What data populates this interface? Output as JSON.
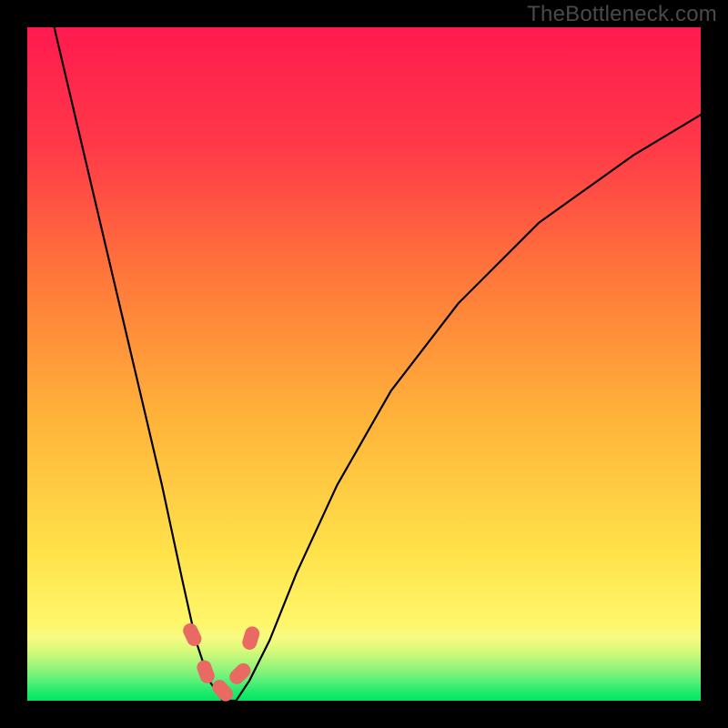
{
  "watermark": "TheBottleneck.com",
  "colors": {
    "frame": "#000000",
    "curve": "#000000",
    "band_green": "#00e661",
    "band_green_mid": "#6cf27a",
    "band_yellowgreen": "#d9f97a",
    "band_yellow": "#fff66a",
    "grad_top": "#ff1a4f",
    "grad_mid1": "#ff6a3a",
    "grad_mid2": "#ffb33a",
    "grad_mid3": "#ffe24a",
    "marker": "#e96a62"
  },
  "chart_data": {
    "type": "line",
    "title": "",
    "xlabel": "",
    "ylabel": "",
    "xlim": [
      0,
      100
    ],
    "ylim": [
      0,
      100
    ],
    "annotations": [
      "TheBottleneck.com"
    ],
    "series": [
      {
        "name": "bottleneck-curve",
        "x": [
          4,
          8,
          12,
          16,
          20,
          23,
          25,
          27,
          29,
          31,
          33,
          36,
          40,
          46,
          54,
          64,
          76,
          90,
          100
        ],
        "y": [
          100,
          83,
          66,
          49,
          32,
          18,
          9,
          3,
          0,
          0,
          3,
          9,
          19,
          32,
          46,
          59,
          71,
          81,
          87
        ]
      }
    ],
    "markers": {
      "name": "highlight-points",
      "x": [
        24.5,
        26.5,
        29.0,
        31.6,
        33.2
      ],
      "y": [
        9.8,
        4.3,
        1.5,
        4.0,
        9.3
      ]
    },
    "grid": false,
    "legend": false
  }
}
